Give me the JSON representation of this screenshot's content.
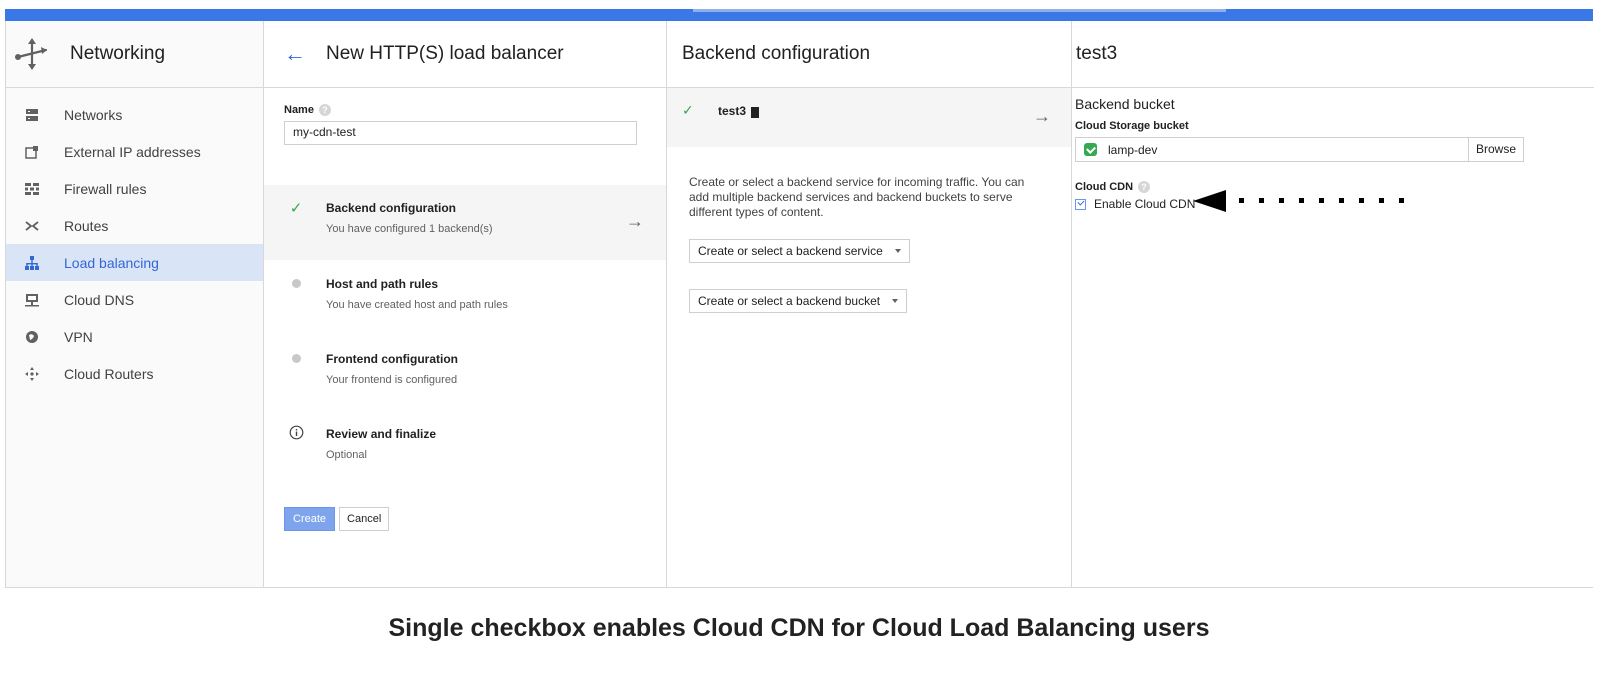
{
  "nav": {
    "title": "Networking",
    "items": [
      {
        "label": "Networks",
        "icon": "networks-icon"
      },
      {
        "label": "External IP addresses",
        "icon": "external-ip-icon"
      },
      {
        "label": "Firewall rules",
        "icon": "firewall-icon"
      },
      {
        "label": "Routes",
        "icon": "routes-icon"
      },
      {
        "label": "Load balancing",
        "icon": "load-balancing-icon",
        "active": true
      },
      {
        "label": "Cloud DNS",
        "icon": "cloud-dns-icon"
      },
      {
        "label": "VPN",
        "icon": "vpn-icon"
      },
      {
        "label": "Cloud Routers",
        "icon": "cloud-routers-icon"
      }
    ]
  },
  "steps_panel": {
    "title": "New HTTP(S) load balancer",
    "name_label": "Name",
    "name_value": "my-cdn-test",
    "steps": [
      {
        "title": "Backend configuration",
        "subtitle": "You have configured 1 backend(s)",
        "status": "done",
        "active": true
      },
      {
        "title": "Host and path rules",
        "subtitle": "You have created host and path rules",
        "status": "pending"
      },
      {
        "title": "Frontend configuration",
        "subtitle": "Your frontend is configured",
        "status": "pending"
      },
      {
        "title": "Review and finalize",
        "subtitle": "Optional",
        "status": "info"
      }
    ],
    "create_label": "Create",
    "cancel_label": "Cancel"
  },
  "backend_panel": {
    "title": "Backend configuration",
    "service_name": "test3",
    "description": "Create or select a backend service for incoming traffic. You can add multiple backend services and backend buckets to serve different types of content.",
    "service_dropdown": "Create or select a backend service",
    "bucket_dropdown": "Create or select a backend bucket"
  },
  "detail_panel": {
    "title": "test3",
    "section_title": "Backend bucket",
    "storage_label": "Cloud Storage bucket",
    "storage_value": "lamp-dev",
    "browse_label": "Browse",
    "cdn_label": "Cloud CDN",
    "cdn_checkbox_label": "Enable Cloud CDN",
    "cdn_enabled": true
  },
  "caption": "Single checkbox enables Cloud CDN for Cloud Load Balancing users",
  "colors": {
    "accent": "#3b78e7",
    "active_nav_bg": "#dae4f7",
    "active_text": "#3367d6",
    "success": "#34a853"
  }
}
